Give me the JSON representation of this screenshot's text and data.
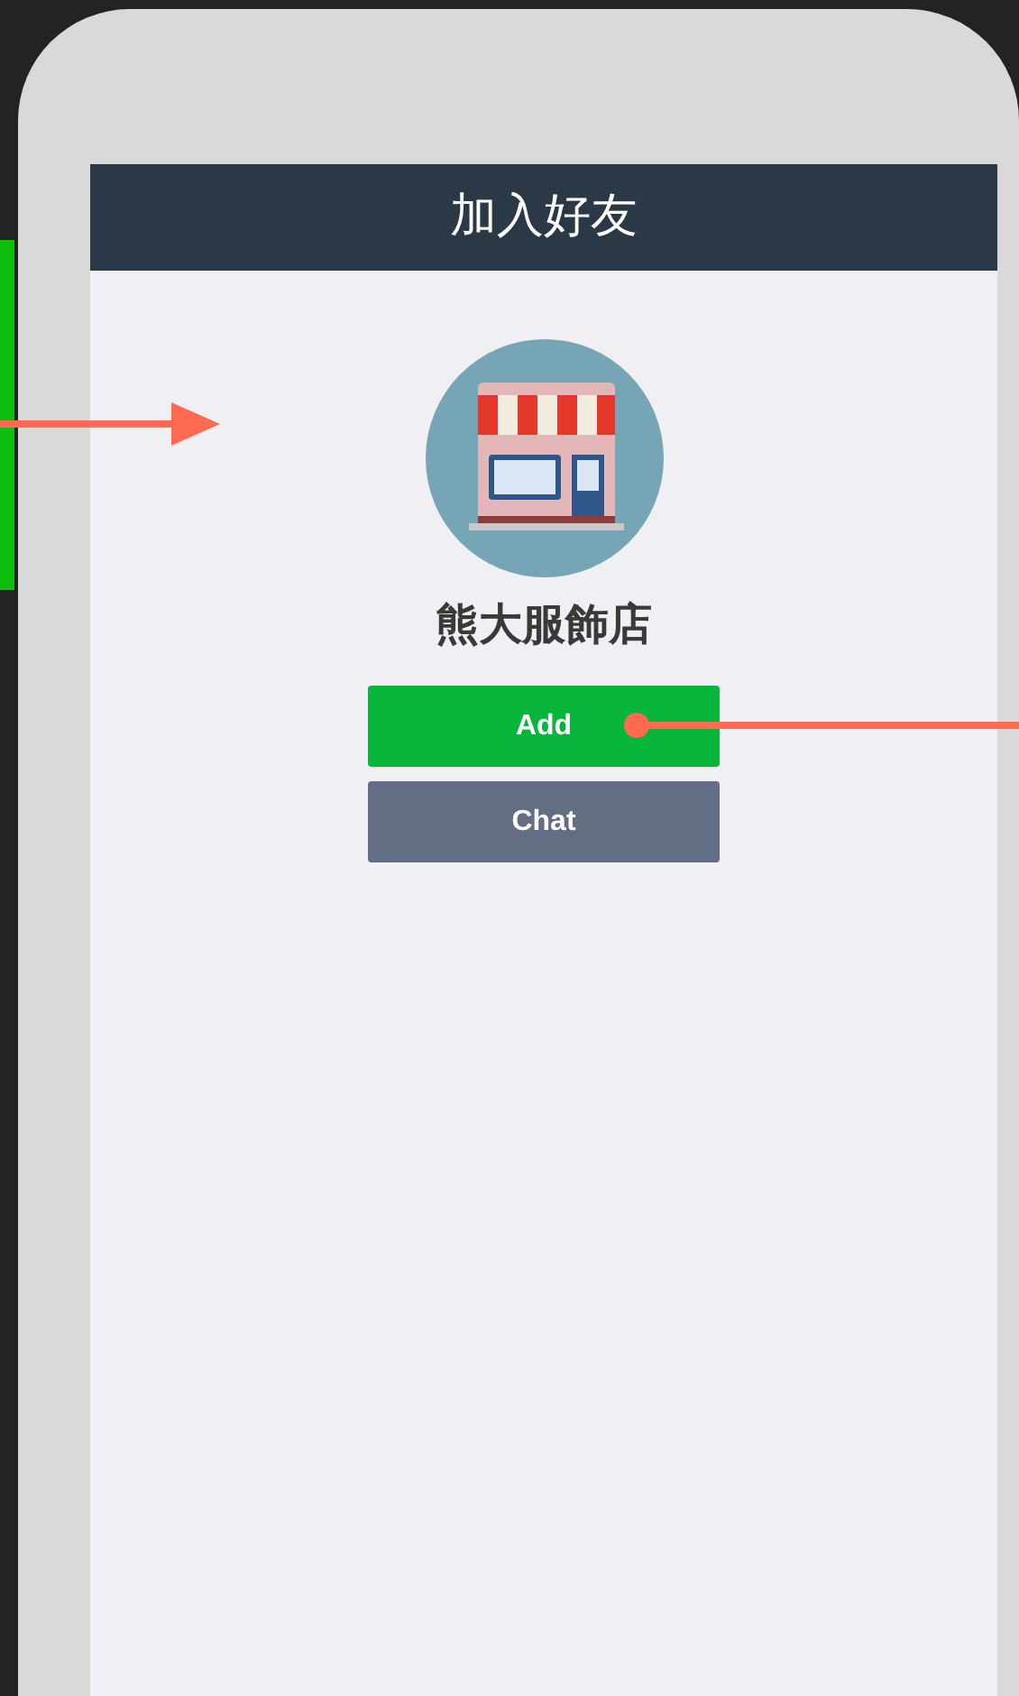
{
  "header": {
    "title": "加入好友"
  },
  "profile": {
    "name": "熊大服飾店"
  },
  "buttons": [
    {
      "label": "Add",
      "kind": "primary"
    },
    {
      "label": "Chat",
      "kind": "secondary"
    }
  ]
}
